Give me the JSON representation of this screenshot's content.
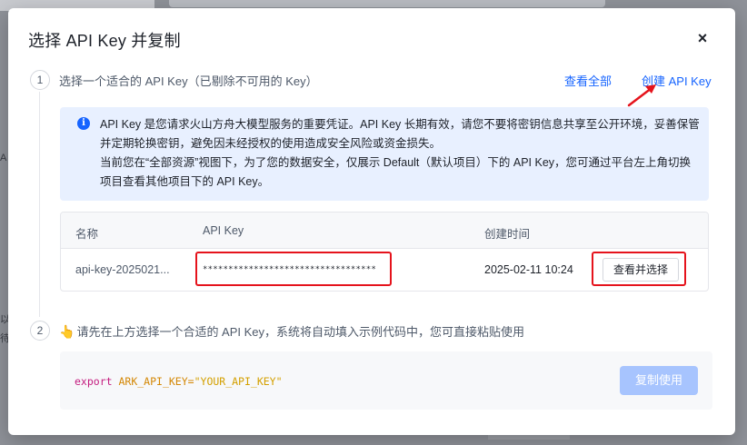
{
  "background": {
    "edge_chars": [
      "A",
      "以",
      "待"
    ]
  },
  "modal": {
    "title": "选择 API Key 并复制",
    "close_label": "×"
  },
  "step1": {
    "number": "1",
    "title": "选择一个适合的 API Key（已剔除不可用的 Key）",
    "link_view_all": "查看全部",
    "link_create": "创建 API Key"
  },
  "info": {
    "icon": "info-icon",
    "para1": "API Key 是您请求火山方舟大模型服务的重要凭证。API Key 长期有效，请您不要将密钥信息共享至公开环境，妥善保管并定期轮换密钥，避免因未经授权的使用造成安全风险或资金损失。",
    "para2": "当前您在“全部资源”视图下，为了您的数据安全，仅展示 Default（默认项目）下的 API Key，您可通过平台左上角切换项目查看其他项目下的 API Key。"
  },
  "table": {
    "headers": {
      "name": "名称",
      "key": "API Key",
      "created": "创建时间"
    },
    "rows": [
      {
        "name": "api-key-2025021...",
        "key": "**********************************",
        "created": "2025-02-11 10:24",
        "action": "查看并选择"
      }
    ]
  },
  "step2": {
    "number": "2",
    "title": "请先在上方选择一个合适的 API Key，系统将自动填入示例代码中，您可直接粘贴使用",
    "hand_icon": "👆"
  },
  "code": {
    "export_kw": "export",
    "var_name": "ARK_API_KEY",
    "equals": "=",
    "value": "\"YOUR_API_KEY\"",
    "copy_label": "复制使用"
  },
  "colors": {
    "primary": "#1664ff",
    "highlight_red": "#e5131c",
    "info_bg": "#e8f0ff",
    "copy_disabled": "#a7c4fe"
  }
}
